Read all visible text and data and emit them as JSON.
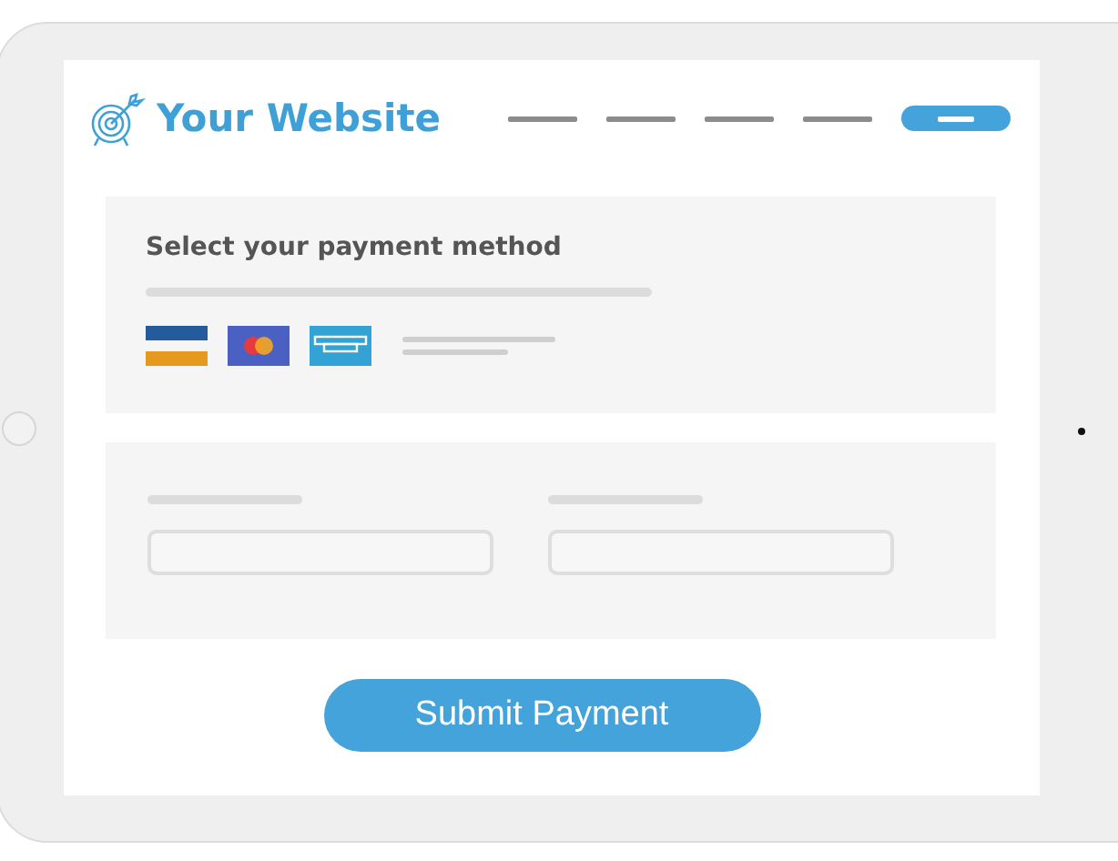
{
  "site_title": "Your Website",
  "nav": [
    {
      "selected": false
    },
    {
      "selected": false
    },
    {
      "selected": false
    },
    {
      "selected": false
    },
    {
      "selected": true
    }
  ],
  "payment_section": {
    "heading": "Select your payment method"
  },
  "submit_button": {
    "label": "Submit Payment"
  }
}
